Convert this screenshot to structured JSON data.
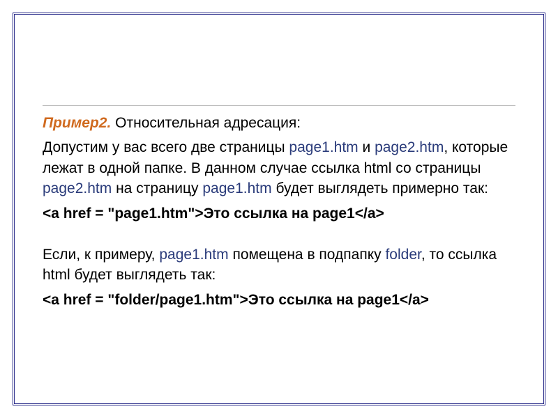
{
  "title_label": "Пример2.",
  "title_rest": " Относительная адресация:",
  "para1_a": "Допустим у вас всего две страницы ",
  "para1_p1": "page1.htm",
  "para1_b": " и ",
  "para1_p2": "page2.htm",
  "para1_c": ", которые лежат в одной папке. В данном случае ссылка html со страницы ",
  "para1_p3": "page2.htm",
  "para1_d": " на страницу ",
  "para1_p4": "page1.htm",
  "para1_e": " будет выглядеть примерно так:",
  "code1": "<a href = \"page1.htm\">Это ссылка на page1</a>",
  "para2_a": "Если, к примеру, ",
  "para2_p1": "page1.htm",
  "para2_b": " помещена в подпапку ",
  "para2_folder": "folder",
  "para2_c": ", то ссылка html будет выглядеть так:",
  "code2": "<a href = \"folder/page1.htm\">Это ссылка на page1</a>"
}
